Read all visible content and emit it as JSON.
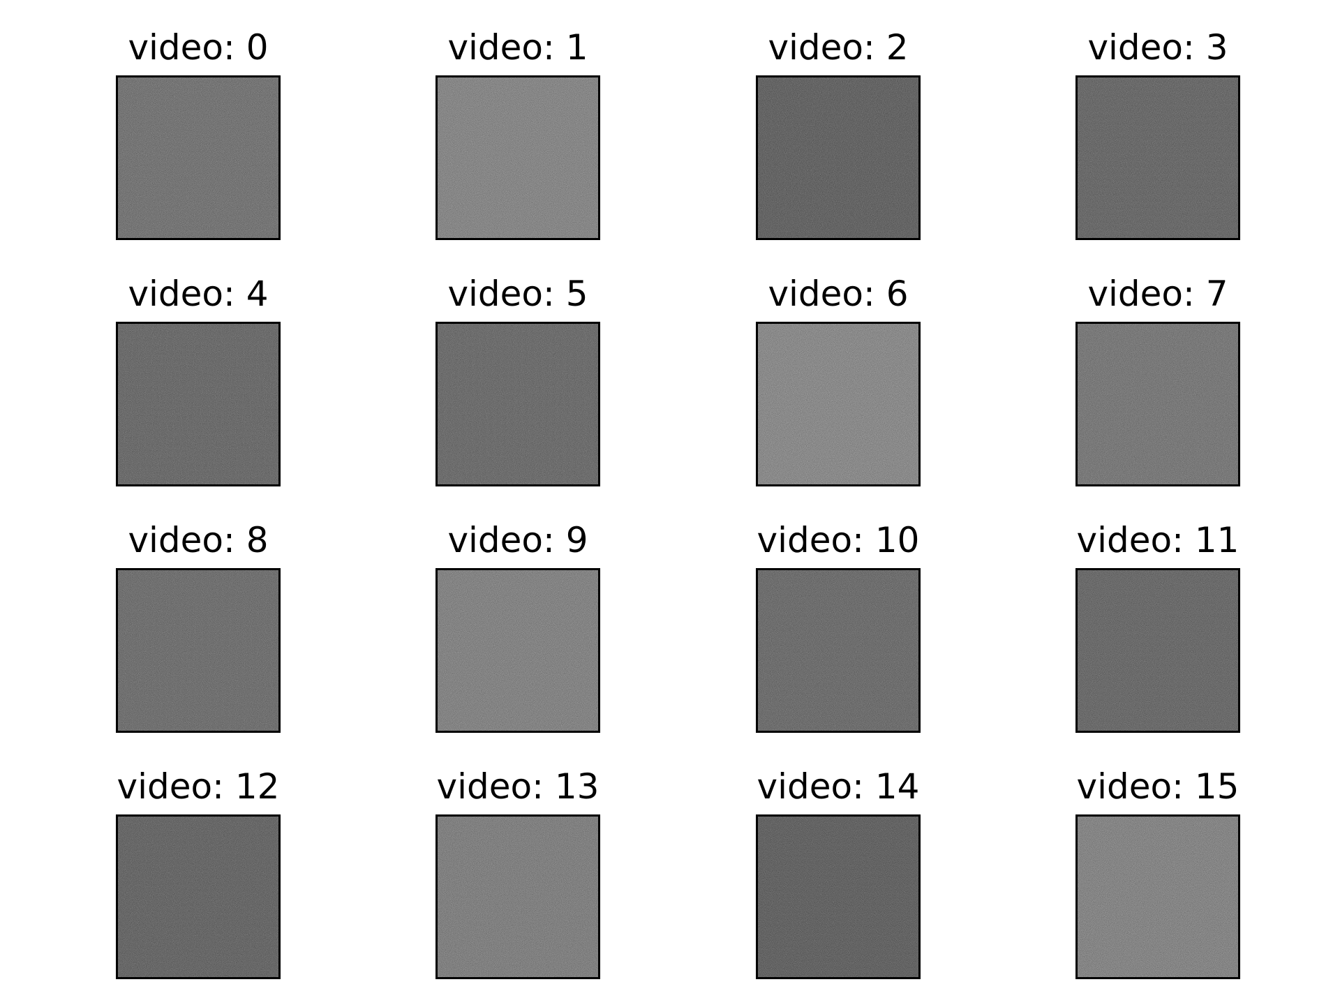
{
  "chart_data": {
    "type": "image-grid",
    "rows": 4,
    "cols": 4,
    "cmap": "gray",
    "axes_visible": false,
    "panels": [
      {
        "title": "video: 0",
        "mean_gray": "#787878"
      },
      {
        "title": "video: 1",
        "mean_gray": "#8e8e8e"
      },
      {
        "title": "video: 2",
        "mean_gray": "#636363"
      },
      {
        "title": "video: 3",
        "mean_gray": "#6a6a6a"
      },
      {
        "title": "video: 4",
        "mean_gray": "#6c6c6c"
      },
      {
        "title": "video: 5",
        "mean_gray": "#6e6e6e"
      },
      {
        "title": "video: 6",
        "mean_gray": "#929292"
      },
      {
        "title": "video: 7",
        "mean_gray": "#7d7d7d"
      },
      {
        "title": "video: 8",
        "mean_gray": "#727272"
      },
      {
        "title": "video: 9",
        "mean_gray": "#8a8a8a"
      },
      {
        "title": "video: 10",
        "mean_gray": "#6f6f6f"
      },
      {
        "title": "video: 11",
        "mean_gray": "#6b6b6b"
      },
      {
        "title": "video: 12",
        "mean_gray": "#676767"
      },
      {
        "title": "video: 13",
        "mean_gray": "#868686"
      },
      {
        "title": "video: 14",
        "mean_gray": "#626262"
      },
      {
        "title": "video: 15",
        "mean_gray": "#8c8c8c"
      }
    ]
  }
}
